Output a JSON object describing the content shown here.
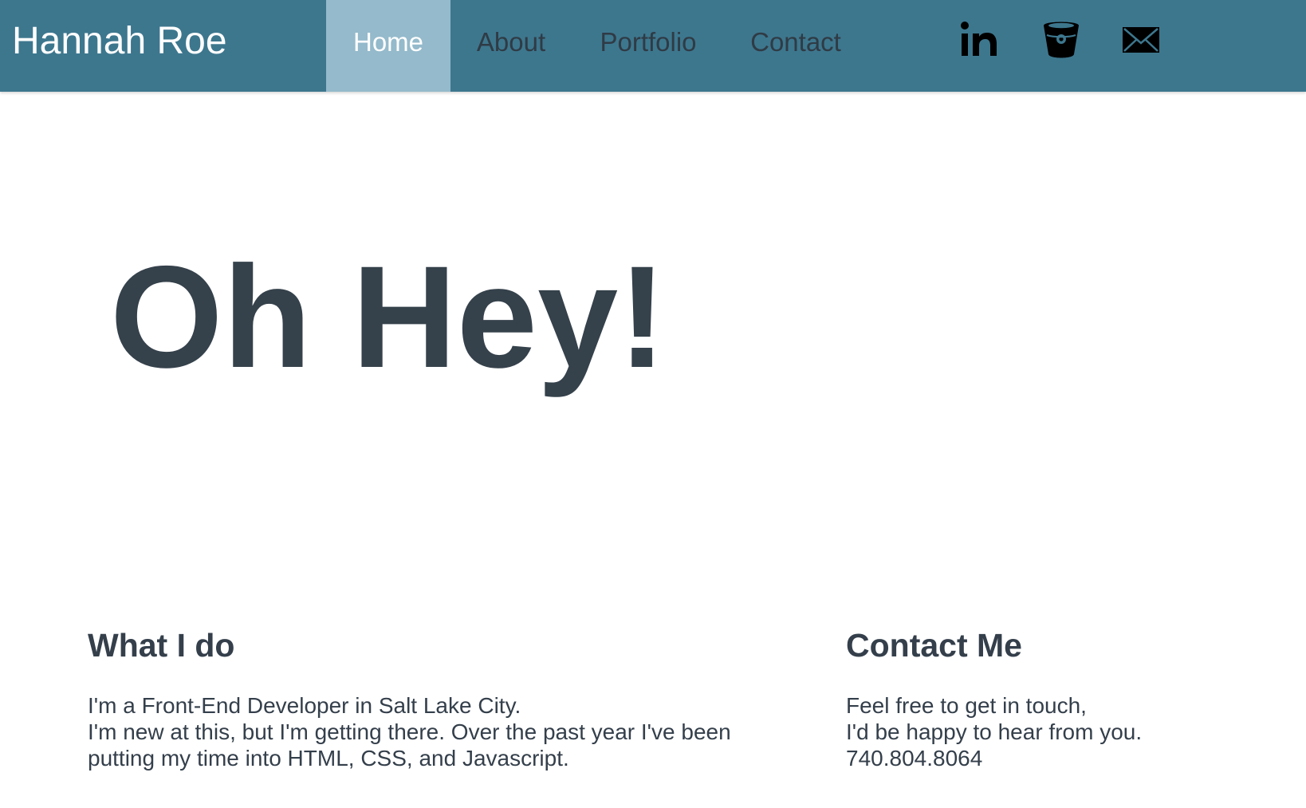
{
  "header": {
    "brand": "Hannah Roe",
    "nav": [
      {
        "label": "Home",
        "active": true
      },
      {
        "label": "About",
        "active": false
      },
      {
        "label": "Portfolio",
        "active": false
      },
      {
        "label": "Contact",
        "active": false
      }
    ],
    "social_icons": [
      "linkedin-icon",
      "bitbucket-icon",
      "mail-icon"
    ]
  },
  "hero": {
    "title": "Oh Hey!"
  },
  "what_i_do": {
    "heading": "What I do",
    "lines": [
      "I'm a Front-End Developer in Salt Lake City.",
      "I'm new at this, but I'm getting there. Over the past year I've been",
      "putting my time into HTML, CSS, and Javascript."
    ]
  },
  "contact": {
    "heading": "Contact Me",
    "lines": [
      "Feel free to get in touch,",
      "I'd be happy to hear from you.",
      "740.804.8064"
    ]
  },
  "colors": {
    "nav_background": "#3d778e",
    "nav_active": "#94bacb",
    "text_dark": "#343f4b"
  }
}
